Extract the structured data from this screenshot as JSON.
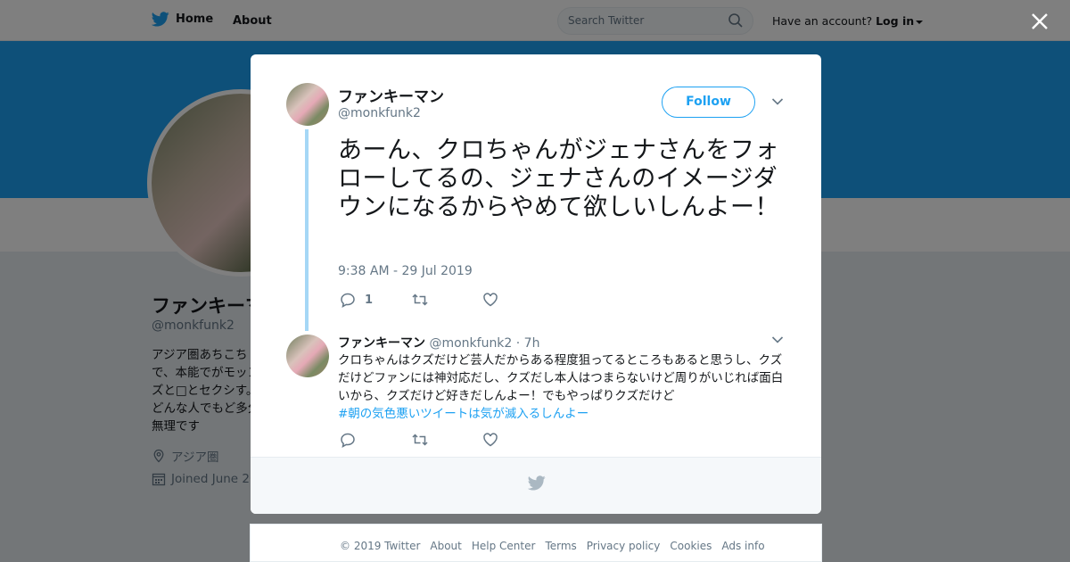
{
  "topbar": {
    "home_label": "Home",
    "about_label": "About",
    "search_placeholder": "Search Twitter",
    "account_prompt": "Have an account?",
    "login_label": "Log in"
  },
  "profile": {
    "name": "ファンキーマ",
    "handle": "@monkfunk2",
    "bio": "アジア圏あちこちで、本能でがモッンズと□とセクシす。どんな人でもど多分無理です",
    "location": "アジア圏",
    "joined": "Joined June 20"
  },
  "tweet": {
    "name": "ファンキーマン",
    "handle": "@monkfunk2",
    "follow_label": "Follow",
    "text": "あーん、クロちゃんがジェナさんをフォローしてるの、ジェナさんのイメージダウンになるからやめて欲しいしんよー！",
    "timestamp": "9:38 AM - 29 Jul 2019",
    "reply_count": "1"
  },
  "reply": {
    "name": "ファンキーマン",
    "handle": "@monkfunk2",
    "age": "· 7h",
    "text": "クロちゃんはクズだけど芸人だからある程度狙ってるところもあると思うし、クズだけどファンには神対応だし、クズだし本人はつまらないけど周りがいじれば面白いから、クズだけど好きだしんよー！でもやっぱりクズだけど",
    "hashtag": "#朝の気色悪いツイートは気が滅入るしんよー"
  },
  "footer": {
    "links": [
      "© 2019 Twitter",
      "About",
      "Help Center",
      "Terms",
      "Privacy policy",
      "Cookies",
      "Ads info"
    ]
  },
  "colors": {
    "brand": "#1da1f2",
    "thread_line": "#a5d7f6",
    "secondary_text": "#657786"
  }
}
